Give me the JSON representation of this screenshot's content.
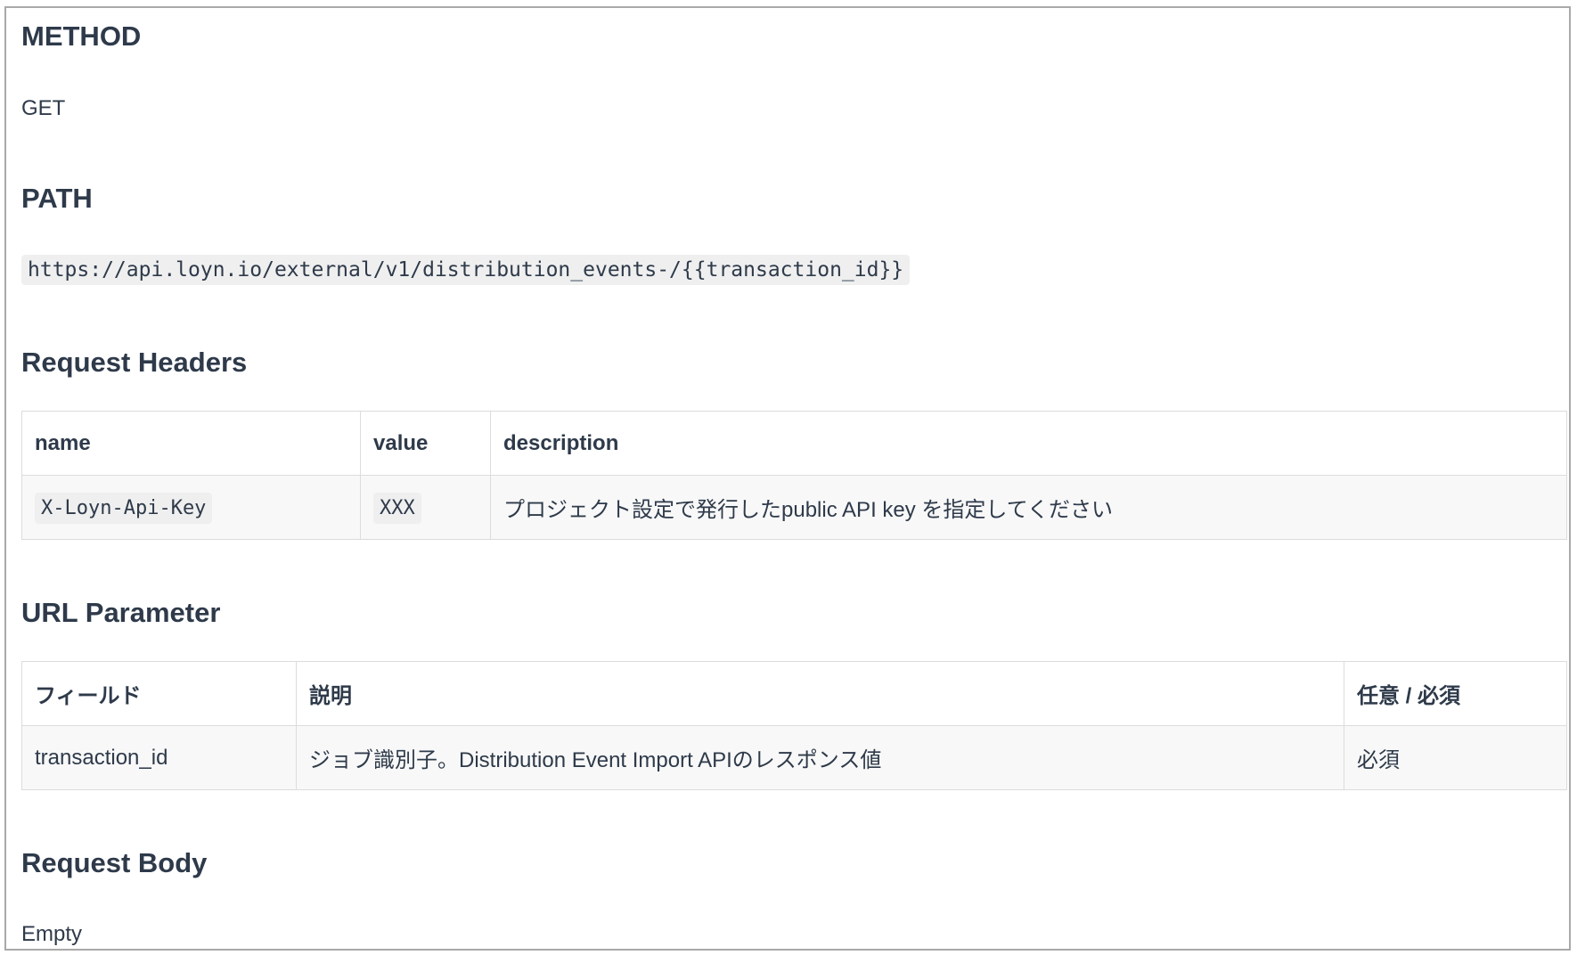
{
  "sections": {
    "method": {
      "heading": "METHOD",
      "value": "GET"
    },
    "path": {
      "heading": "PATH",
      "url": "https://api.loyn.io/external/v1/distribution_events-/{{transaction_id}}"
    },
    "request_headers": {
      "heading": "Request Headers",
      "columns": [
        "name",
        "value",
        "description"
      ],
      "rows": [
        {
          "name": "X-Loyn-Api-Key",
          "value": "XXX",
          "description": "プロジェクト設定で発行したpublic API key を指定してください"
        }
      ]
    },
    "url_parameter": {
      "heading": "URL Parameter",
      "columns": [
        "フィールド",
        "説明",
        "任意 / 必須"
      ],
      "rows": [
        {
          "field": "transaction_id",
          "description": "ジョブ識別子。Distribution Event Import APIのレスポンス値",
          "required": "必須"
        }
      ]
    },
    "request_body": {
      "heading": "Request Body",
      "value": "Empty"
    }
  }
}
